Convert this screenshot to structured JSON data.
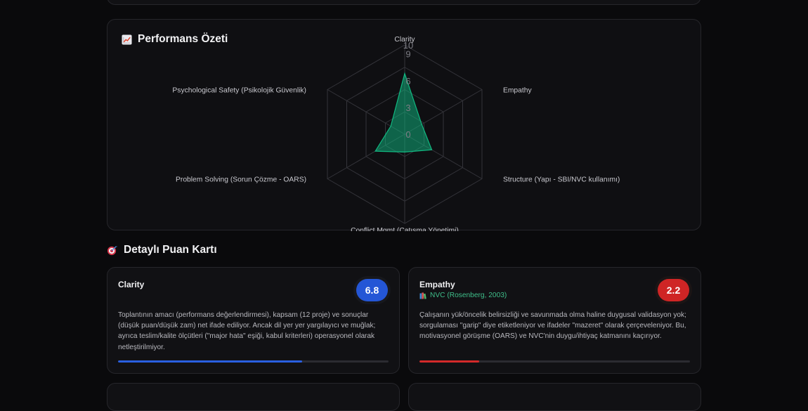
{
  "performance_summary": {
    "title": "Performans Özeti",
    "icon": "chart-increasing-icon",
    "chart_data": {
      "type": "radar",
      "axes": [
        "Clarity",
        "Empathy",
        "Structure (Yapı - SBI/NVC kullanımı)",
        "Conflict Mgmt (Çatışma Yönetimi)",
        "Problem Solving (Sorun Çözme - OARS)",
        "Psychological Safety (Psikolojik Güvenlik)"
      ],
      "series": [
        {
          "values": [
            6.8,
            2.2,
            3.5,
            2.0,
            3.8,
            1.8
          ],
          "color": "#10b981"
        }
      ],
      "rlim": [
        0,
        10
      ],
      "tick_values": [
        0,
        3,
        6,
        9,
        10
      ],
      "tick_labels": [
        "0",
        "3",
        "6",
        "9",
        "10"
      ],
      "grid": true
    }
  },
  "scorecard": {
    "title": "Detaylı Puan Kartı",
    "icon": "target-icon",
    "items": [
      {
        "name": "Clarity",
        "score": "6.8",
        "score_value": 6.8,
        "color": "#2456d6",
        "description": "Toplantının amacı (performans değerlendirmesi), kapsam (12 proje) ve sonuçlar (düşük puan/düşük zam) net ifade ediliyor. Ancak dil yer yer yargılayıcı ve muğlak; ayrıca teslim/kalite ölçütleri (\"major hata\" eşiği, kabul kriterleri) operasyonel olarak netleştirilmiyor."
      },
      {
        "name": "Empathy",
        "reference": "NVC (Rosenberg, 2003)",
        "reference_icon": "books-icon",
        "score": "2.2",
        "score_value": 2.2,
        "color": "#cf2525",
        "description": "Çalışanın yük/öncelik belirsizliği ve savunmada olma haline duygusal validasyon yok; sorgulaması \"garip\" diye etiketleniyor ve ifadeler \"mazeret\" olarak çerçeveleniyor. Bu, motivasyonel görüşme (OARS) ve NVC'nin duygu/ihtiyaç katmanını kaçırıyor."
      }
    ]
  }
}
